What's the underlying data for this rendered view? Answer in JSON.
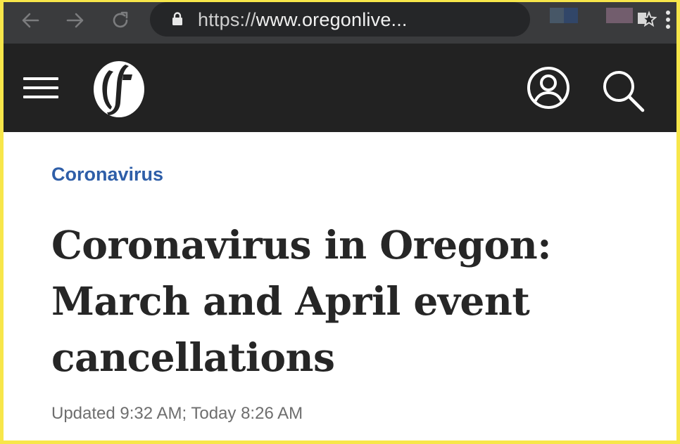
{
  "browser": {
    "url_scheme": "https://",
    "url_rest": "www.oregonlive...",
    "colors": {
      "toolbar": "#3a3b3d",
      "urlbar": "#252628"
    }
  },
  "site": {
    "icons": {
      "menu": "hamburger-icon",
      "logo": "oregonian-o-logo",
      "account": "user-icon",
      "search": "search-icon"
    },
    "header_color": "#222222"
  },
  "article": {
    "section": "Coronavirus",
    "headline": "Coronavirus in Oregon: March and April event cancellations",
    "timestamp": "Updated 9:32 AM; Today 8:26 AM",
    "accent_color": "#2e5ea8"
  }
}
